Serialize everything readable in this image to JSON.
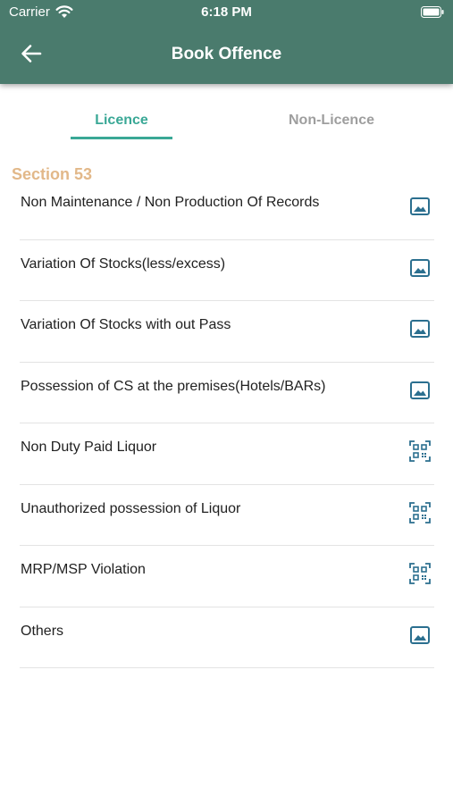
{
  "status_bar": {
    "carrier": "Carrier",
    "time": "6:18 PM"
  },
  "header": {
    "title": "Book Offence",
    "back_icon": "arrow-left-icon"
  },
  "tabs": [
    {
      "label": "Licence",
      "selected": true
    },
    {
      "label": "Non-Licence",
      "selected": false
    }
  ],
  "section": {
    "title": "Section 53"
  },
  "items": [
    {
      "label": "Non Maintenance / Non Production  Of Records",
      "icon": "image-icon"
    },
    {
      "label": "Variation Of Stocks(less/excess)",
      "icon": "image-icon"
    },
    {
      "label": "Variation Of Stocks with out Pass",
      "icon": "image-icon"
    },
    {
      "label": "Possession of CS at the premises(Hotels/BARs)",
      "icon": "image-icon"
    },
    {
      "label": "Non Duty Paid Liquor",
      "icon": "qr-scan-icon"
    },
    {
      "label": "Unauthorized possession of Liquor",
      "icon": "qr-scan-icon"
    },
    {
      "label": "MRP/MSP Violation",
      "icon": "qr-scan-icon"
    },
    {
      "label": "Others",
      "icon": "image-icon"
    }
  ],
  "colors": {
    "header_bg": "#4a7b6d",
    "tab_active": "#3aa896",
    "tab_inactive": "#9e9e9e",
    "section_title": "#e2b889",
    "icon": "#2b6f8f"
  }
}
